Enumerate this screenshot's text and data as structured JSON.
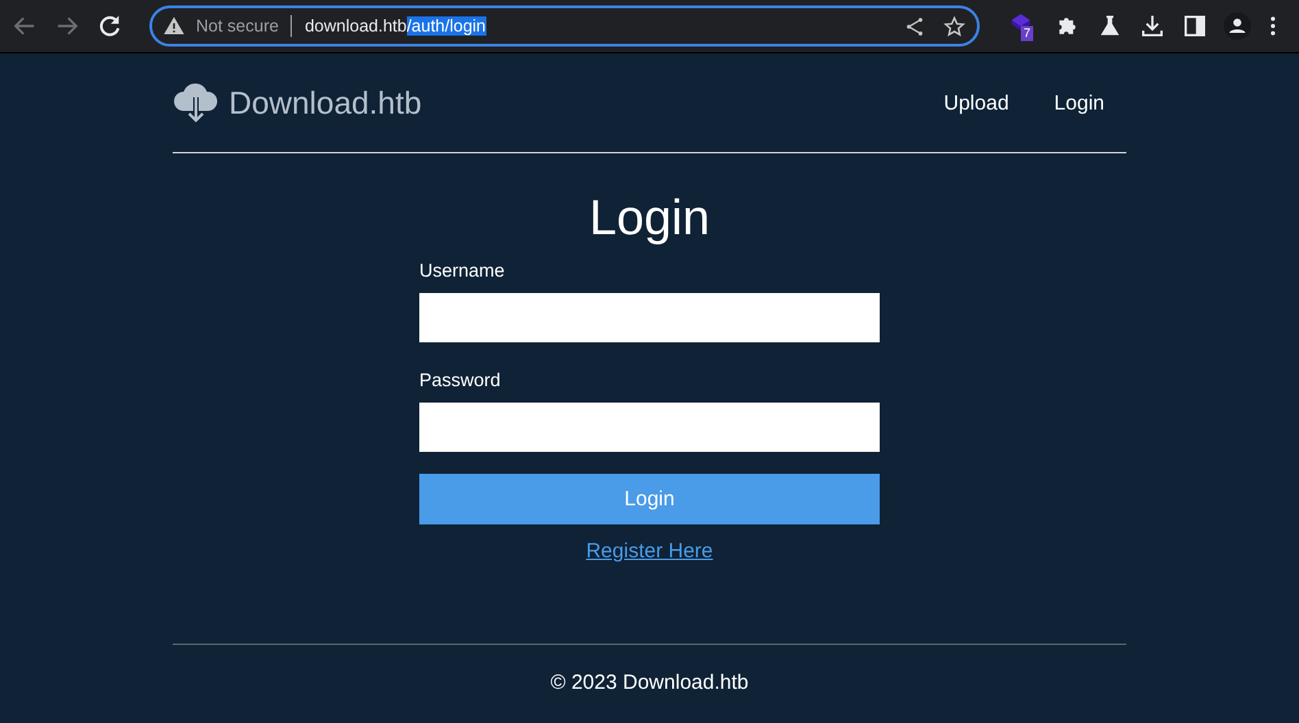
{
  "browser": {
    "security": "Not secure",
    "url_host": "download.htb",
    "url_path": "/auth/login",
    "url_path_selected": true,
    "extension_badge": "7"
  },
  "header": {
    "brand": "Download.htb",
    "nav": [
      "Upload",
      "Login"
    ]
  },
  "form": {
    "title": "Login",
    "fields": [
      {
        "label": "Username"
      },
      {
        "label": "Password"
      }
    ],
    "submit": "Login",
    "link": "Register Here"
  },
  "footer": "© 2023 Download.htb"
}
